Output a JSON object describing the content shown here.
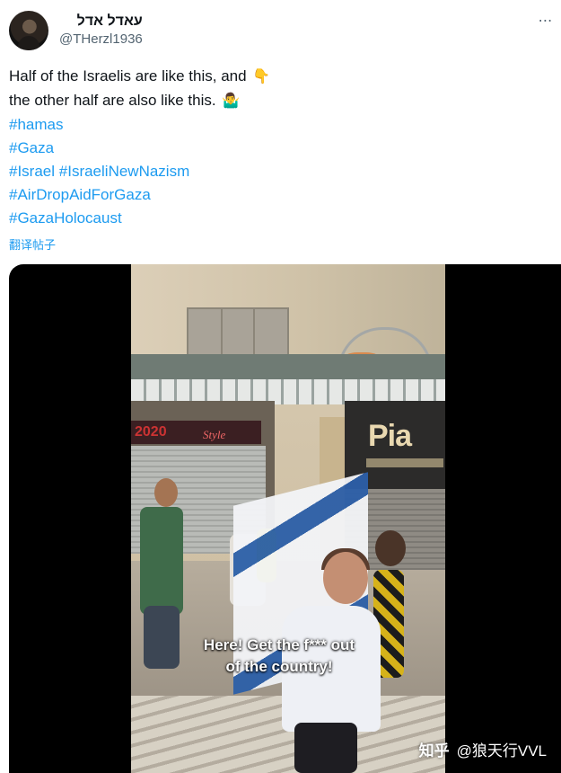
{
  "author": {
    "display_name": "עאדל אדל",
    "handle": "@THerzl1936"
  },
  "more_icon": "⋯",
  "tweet": {
    "line1": "Half of the Israelis are like this, and",
    "line1_emoji": "👇",
    "line2": "the other half are also like this.",
    "line2_emoji": "🤷‍♂️",
    "hashtags": {
      "h1": "#hamas",
      "h2": "#Gaza",
      "h3a": "#Israel",
      "h3b": "#IsraeliNewNazism",
      "h4": "#AirDropAidForGaza",
      "h5": "#GazaHolocaust"
    },
    "translate_label": "翻译帖子"
  },
  "media": {
    "caption_line1": "Here! Get the f*** out",
    "caption_line2": "of the country!",
    "sign_left": "2020",
    "sign_left_style": "Style",
    "sign_right": "Pia",
    "watermark_site": "知乎",
    "watermark_user": "@狼天行VVL"
  },
  "icons": [
    "more-icon",
    "avatar"
  ],
  "colors": {
    "link": "#1d9bf0",
    "secondary_text": "#536471",
    "flag_blue": "#2c5fa8"
  }
}
